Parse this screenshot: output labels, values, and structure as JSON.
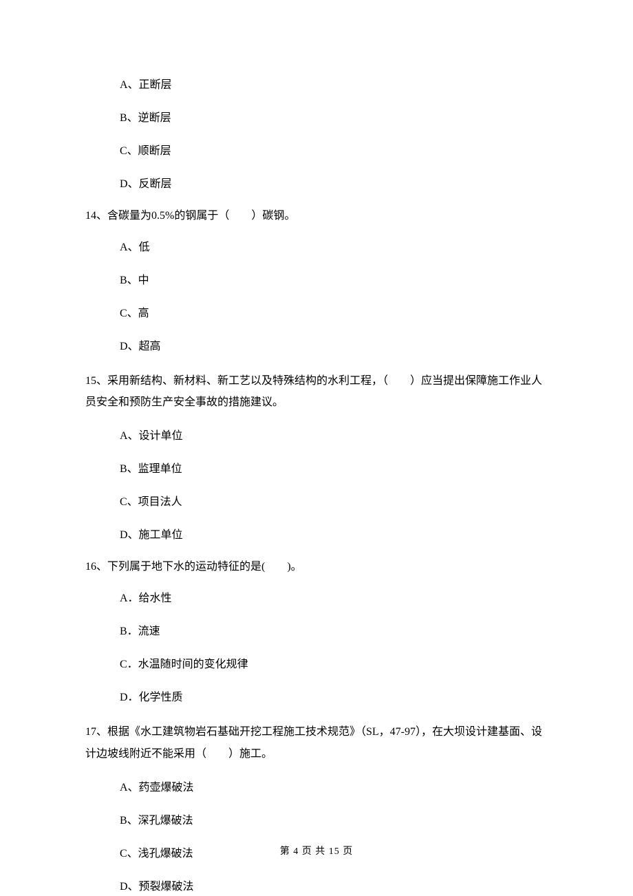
{
  "q13": {
    "options": {
      "a": "A、正断层",
      "b": "B、逆断层",
      "c": "C、顺断层",
      "d": "D、反断层"
    }
  },
  "q14": {
    "text": "14、含碳量为0.5%的钢属于（　　）碳钢。",
    "options": {
      "a": "A、低",
      "b": "B、中",
      "c": "C、高",
      "d": "D、超高"
    }
  },
  "q15": {
    "text": "15、采用新结构、新材料、新工艺以及特殊结构的水利工程，（　　）应当提出保障施工作业人员安全和预防生产安全事故的措施建议。",
    "options": {
      "a": "A、设计单位",
      "b": "B、监理单位",
      "c": "C、项目法人",
      "d": "D、施工单位"
    }
  },
  "q16": {
    "text": "16、下列属于地下水的运动特征的是(　　)。",
    "options": {
      "a": "A．给水性",
      "b": "B．流速",
      "c": "C．水温随时间的变化规律",
      "d": "D．化学性质"
    }
  },
  "q17": {
    "text": "17、根据《水工建筑物岩石基础开挖工程施工技术规范》（SL，47-97），在大坝设计建基面、设计边坡线附近不能采用（　　）施工。",
    "options": {
      "a": "A、药壶爆破法",
      "b": "B、深孔爆破法",
      "c": "C、浅孔爆破法",
      "d": "D、预裂爆破法"
    }
  },
  "footer": "第 4 页 共 15 页"
}
